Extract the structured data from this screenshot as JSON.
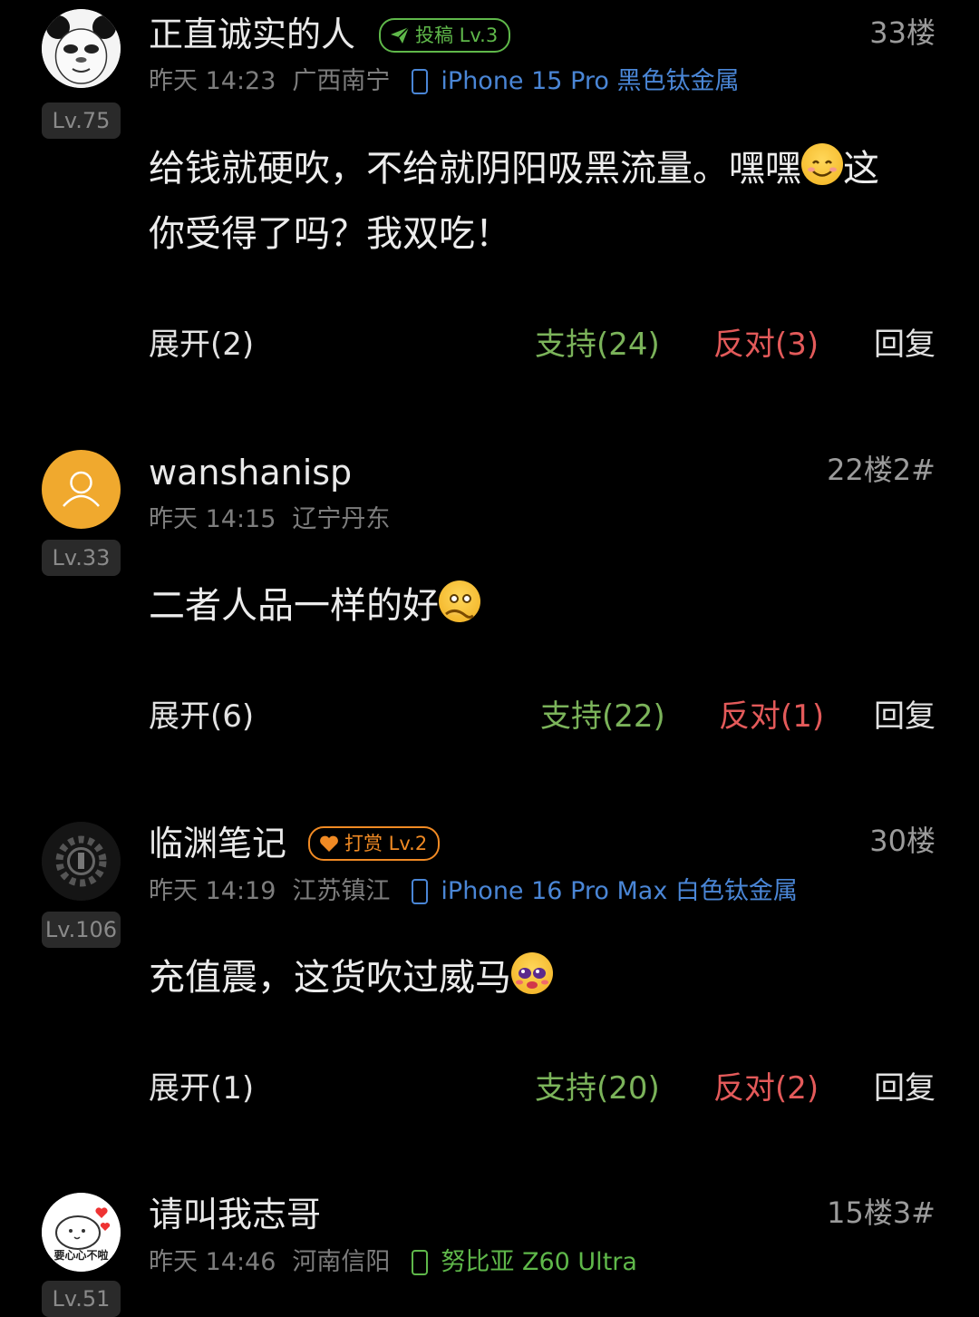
{
  "comments": [
    {
      "username": "正直诚实的人",
      "badge": {
        "icon": "paper-plane-icon",
        "label": "投稿 Lv.3",
        "color": "#5fb84a"
      },
      "floor": "33楼",
      "level": "Lv.75",
      "time": "昨天 14:23",
      "location": "广西南宁",
      "device": "iPhone 15 Pro 黑色钛金属",
      "device_color": "#4a86d6",
      "body_line1": "给钱就硬吹，不给就阴阳吸黑流量。嘿嘿",
      "body_line1_tail": "这",
      "body_line2": "你受得了吗？我双吃！",
      "emoji": "smile-emoji",
      "expand": "展开(2)",
      "support": "支持(24)",
      "oppose": "反对(3)",
      "reply": "回复",
      "avatar": "panda-meme-avatar"
    },
    {
      "username": "wanshanisp",
      "floor": "22楼2#",
      "level": "Lv.33",
      "time": "昨天 14:15",
      "location": "辽宁丹东",
      "body": "二者人品一样的好",
      "emoji": "covering-mouth-emoji",
      "expand": "展开(6)",
      "support": "支持(22)",
      "oppose": "反对(1)",
      "reply": "回复",
      "avatar": "default-user-avatar",
      "avatar_color": "#f0a92e"
    },
    {
      "username": "临渊笔记",
      "badge": {
        "icon": "heart-icon",
        "label": "打赏 Lv.2",
        "color": "#f08a24"
      },
      "floor": "30楼",
      "level": "Lv.106",
      "time": "昨天 14:19",
      "location": "江苏镇江",
      "device": "iPhone 16 Pro Max 白色钛金属",
      "device_color": "#4a86d6",
      "body": "充值震，这货吹过威马",
      "emoji": "blushing-emoji",
      "expand": "展开(1)",
      "support": "支持(20)",
      "oppose": "反对(2)",
      "reply": "回复",
      "avatar": "gear-dark-avatar"
    },
    {
      "username": "请叫我志哥",
      "floor": "15楼3#",
      "level": "Lv.51",
      "time": "昨天 14:46",
      "location": "河南信阳",
      "device": "努比亚 Z60 Ultra",
      "device_color": "#5fb84a",
      "avatar": "cartoon-heart-avatar",
      "avatar_text": "要心心不啦"
    }
  ]
}
